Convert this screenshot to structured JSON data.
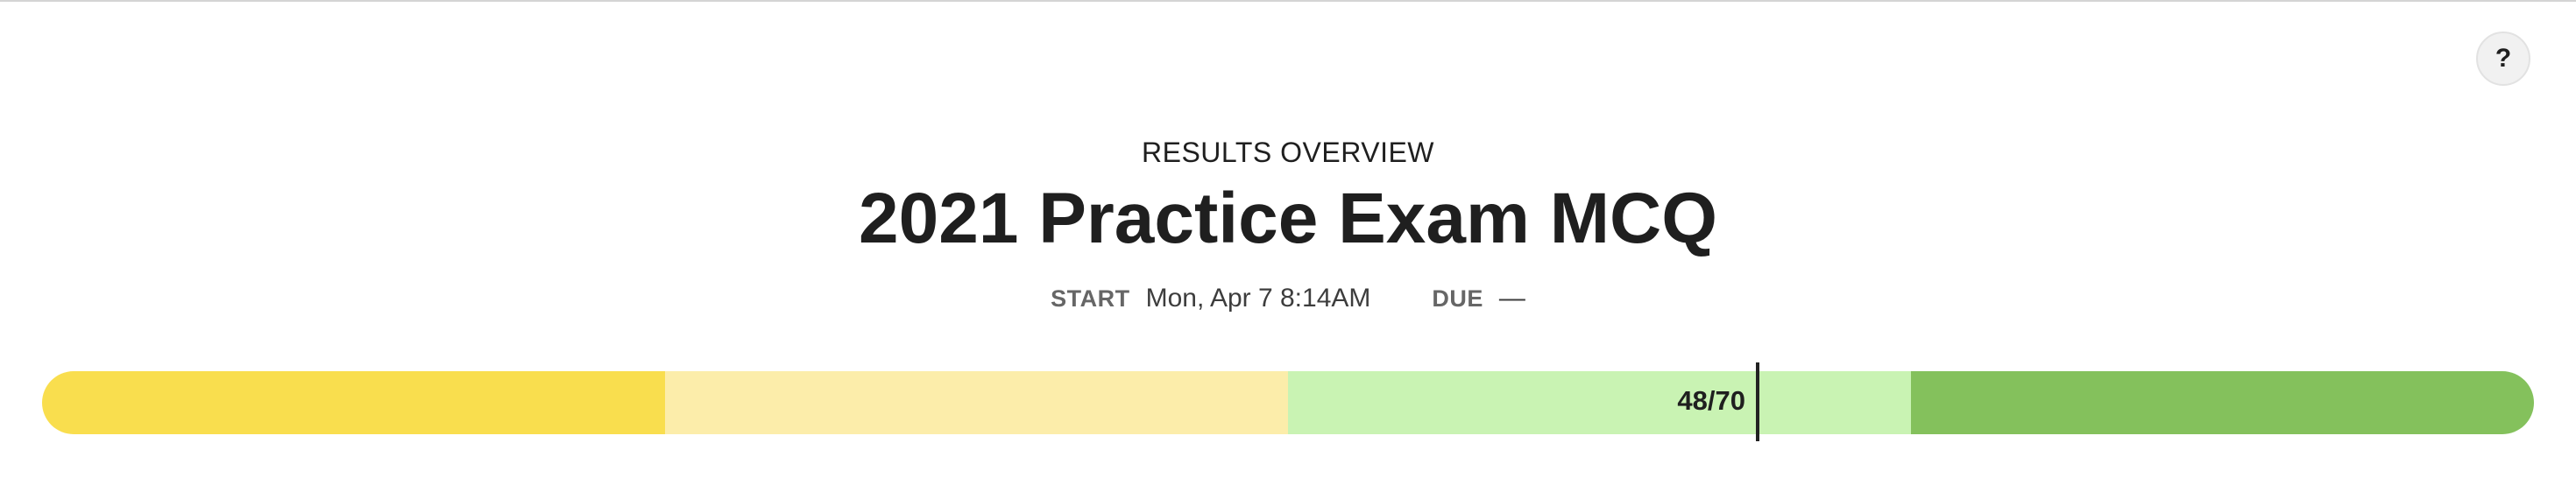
{
  "header": {
    "help_label": "?"
  },
  "overview": {
    "label": "RESULTS OVERVIEW",
    "title": "2021 Practice Exam MCQ"
  },
  "meta": {
    "start_key": "START",
    "start_value": "Mon, Apr 7 8:14AM",
    "due_key": "DUE",
    "due_value": "—"
  },
  "score": {
    "label": "48/70",
    "correct": 48,
    "total": 70,
    "fraction": 0.6857
  },
  "progress_bands": {
    "colors": [
      "#f9de4e",
      "#fcedaa",
      "#c9f3b3",
      "#84c15c"
    ]
  }
}
